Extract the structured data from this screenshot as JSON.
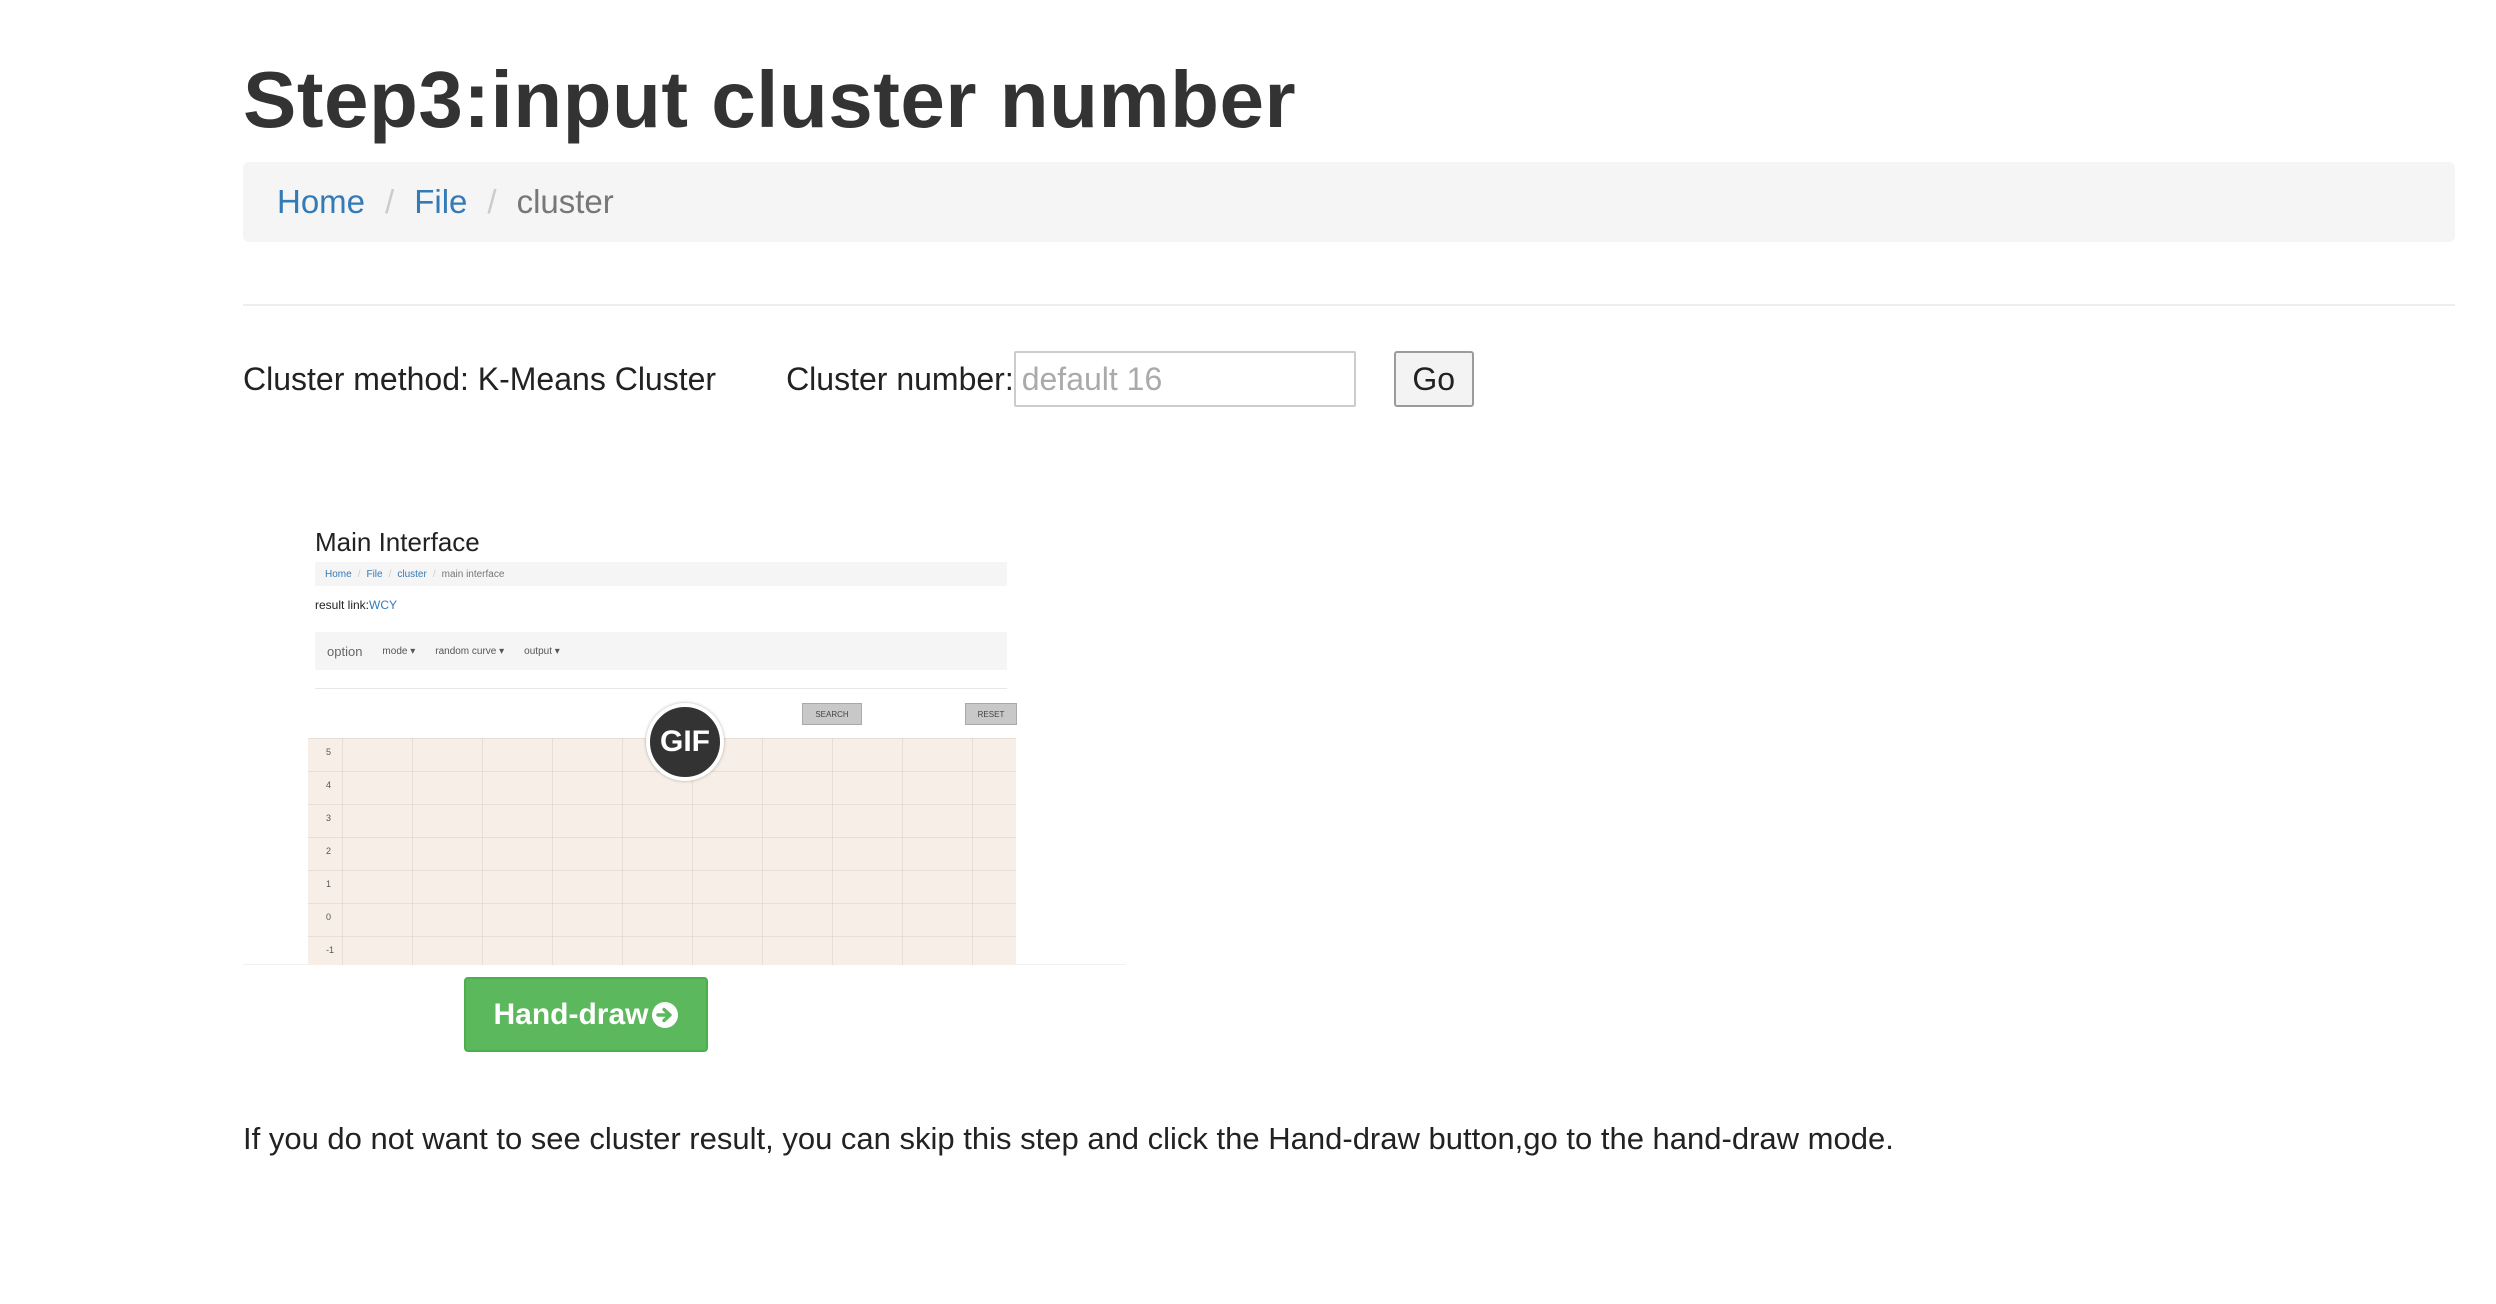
{
  "page": {
    "title": "Step3:input cluster number"
  },
  "breadcrumb": {
    "items": [
      {
        "label": "Home"
      },
      {
        "label": "File"
      }
    ],
    "current": "cluster",
    "separator": "/"
  },
  "form": {
    "method_text": "Cluster method: K-Means Cluster",
    "number_label": "Cluster number:",
    "number_value": "",
    "number_placeholder": "default 16",
    "go_label": "Go"
  },
  "preview": {
    "badge": "GIF",
    "title": "Main Interface",
    "breadcrumb": [
      "Home",
      "File",
      "cluster"
    ],
    "breadcrumb_current": "main interface",
    "result_label": "result link:",
    "result_link": "WCY",
    "option_label": "option",
    "dropdowns": [
      "mode ▾",
      "random curve ▾",
      "output ▾"
    ],
    "search_label": "SEARCH",
    "reset_label": "RESET",
    "y_ticks": [
      "5",
      "4",
      "3",
      "2",
      "1",
      "0",
      "-1"
    ]
  },
  "hand_draw": {
    "label": "Hand-draw",
    "icon": "circle-arrow-right-icon",
    "color": "#5cb85c"
  },
  "note": "If you do not want to see cluster result, you can skip this step and click the Hand-draw button,go to the hand-draw mode.",
  "colors": {
    "link": "#337ab7",
    "breadcrumb_bg": "#f5f5f5",
    "success": "#5cb85c"
  }
}
